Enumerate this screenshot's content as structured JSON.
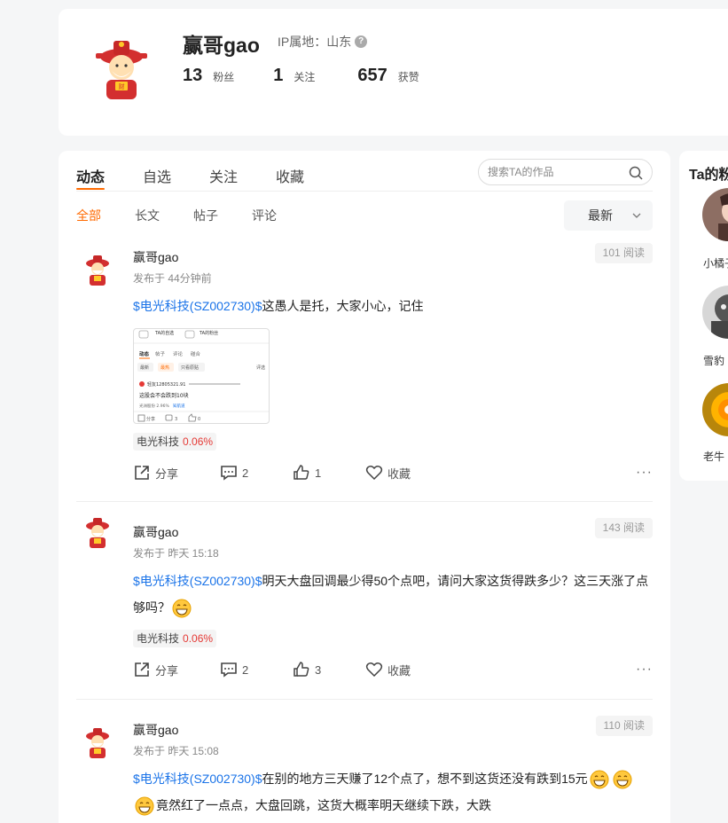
{
  "profile": {
    "username": "赢哥gao",
    "ip_label": "IP属地：山东",
    "stats": [
      {
        "num": "13",
        "label": "粉丝"
      },
      {
        "num": "1",
        "label": "关注"
      },
      {
        "num": "657",
        "label": "获赞"
      }
    ]
  },
  "tabs": [
    "动态",
    "自选",
    "关注",
    "收藏"
  ],
  "search": {
    "placeholder": "搜索TA的作品"
  },
  "subtabs": [
    "全部",
    "长文",
    "帖子",
    "评论"
  ],
  "sort": {
    "label": "最新"
  },
  "posts": [
    {
      "name": "赢哥gao",
      "time": "发布于 44分钟前",
      "reads": "101 阅读",
      "stock_link": "$电光科技(SZ002730)$",
      "text": "这愚人是托，大家小心，记住",
      "tag_name": "电光科技",
      "tag_pct": "0.06%",
      "share": "分享",
      "comments": "2",
      "likes": "1",
      "fav": "收藏"
    },
    {
      "name": "赢哥gao",
      "time": "发布于 昨天 15:18",
      "reads": "143 阅读",
      "stock_link": "$电光科技(SZ002730)$",
      "text": "明天大盘回调最少得50个点吧，请问大家这货得跌多少？这三天涨了点",
      "text2": "够吗？",
      "tag_name": "电光科技",
      "tag_pct": "0.06%",
      "share": "分享",
      "comments": "2",
      "likes": "3",
      "fav": "收藏"
    },
    {
      "name": "赢哥gao",
      "time": "发布于 昨天 15:08",
      "reads": "110 阅读",
      "stock_link": "$电光科技(SZ002730)$",
      "text": "在别的地方三天赚了12个点了，想不到这货还没有跌到15元",
      "text2": "竟然红了一点点，大盘回跳，这货大概率明天继续下跌，大跌"
    }
  ],
  "image_preview": {
    "header1": "TA的自选",
    "header2": "TA的粉丝",
    "tabs": [
      "动态",
      "帖子",
      "评论",
      "碰合"
    ],
    "subtabs": [
      "最新",
      "最热",
      "只看原贴"
    ],
    "comment_btn": "评选",
    "user": "轻友12805321.91",
    "content": "这股会不会跌到10块",
    "meta": "光洲股份 2.96%",
    "meta2": "知航道",
    "share": "分享",
    "comments": "3",
    "likes": "0"
  },
  "fans_panel": {
    "title": "Ta的粉丝",
    "fans": [
      {
        "name": "小橘子"
      },
      {
        "name": "雪豹"
      },
      {
        "name": "老牛"
      }
    ]
  },
  "colors": {
    "accent": "#ff6a00",
    "link": "#1a73e8",
    "up": "#e53935"
  }
}
